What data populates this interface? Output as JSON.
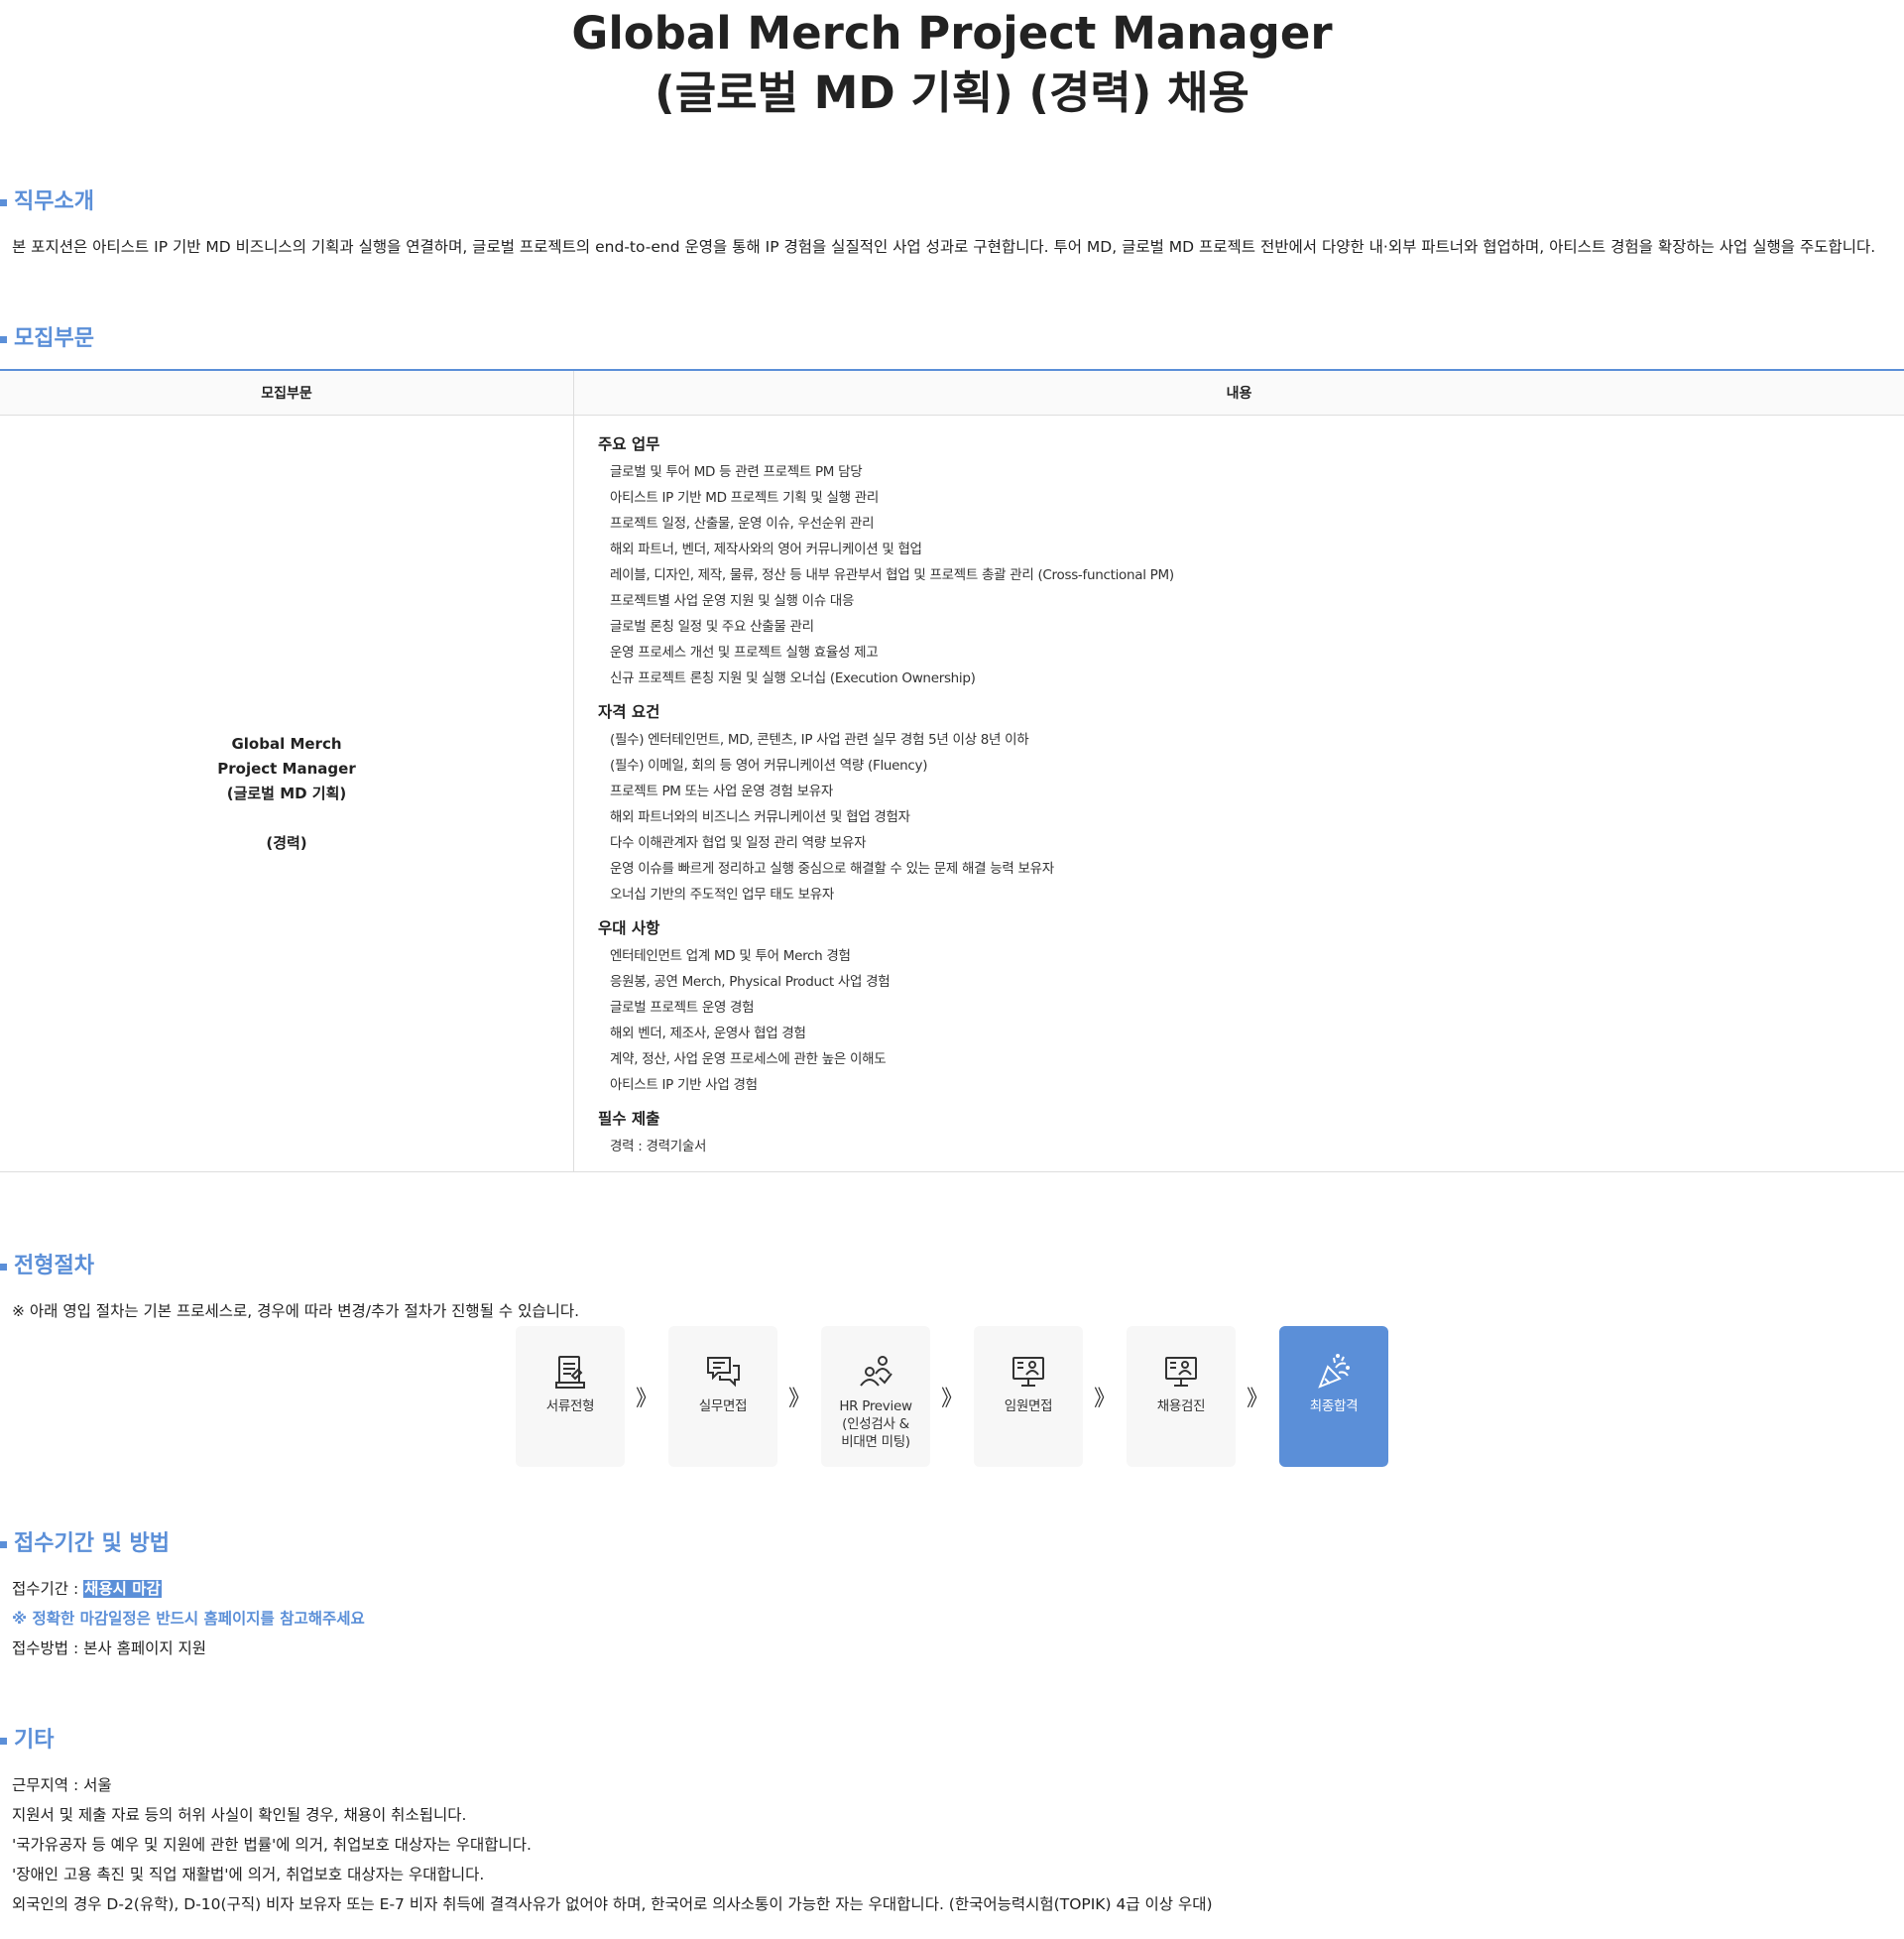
{
  "title": {
    "line1": "Global Merch Project Manager",
    "line2": "(글로벌 MD 기획) (경력) 채용"
  },
  "intro": {
    "heading": "직무소개",
    "text": "본 포지션은 아티스트 IP 기반 MD 비즈니스의 기획과 실행을 연결하며, 글로벌 프로젝트의 end-to-end 운영을 통해 IP 경험을 실질적인 사업 성과로 구현합니다. 투어 MD, 글로벌 MD 프로젝트 전반에서 다양한 내·외부 파트너와 협업하며, 아티스트 경험을 확장하는 사업 실행을 주도합니다."
  },
  "recruit": {
    "heading": "모집부문",
    "col_a_header": "모집부문",
    "col_b_header": "내용",
    "position": {
      "line1": "Global Merch",
      "line2": "Project Manager",
      "line3": "(글로벌 MD 기획)",
      "line4": "(경력)"
    },
    "groups": [
      {
        "title": "주요 업무",
        "items": [
          "글로벌 및 투어 MD 등 관련 프로젝트 PM 담당",
          "아티스트 IP 기반 MD 프로젝트 기획 및 실행 관리",
          "프로젝트 일정, 산출물, 운영 이슈, 우선순위 관리",
          "해외 파트너, 벤더, 제작사와의 영어 커뮤니케이션 및 협업",
          "레이블, 디자인, 제작, 물류, 정산 등 내부 유관부서 협업 및 프로젝트 총괄 관리 (Cross-functional PM)",
          "프로젝트별 사업 운영 지원 및 실행 이슈 대응",
          "글로벌 론칭 일정 및 주요 산출물 관리",
          "운영 프로세스 개선 및 프로젝트 실행 효율성 제고",
          "신규 프로젝트 론칭 지원 및 실행 오너십 (Execution Ownership)"
        ]
      },
      {
        "title": "자격 요건",
        "items": [
          "(필수) 엔터테인먼트, MD, 콘텐츠, IP 사업 관련 실무 경험 5년 이상 8년 이하",
          "(필수) 이메일, 회의 등 영어 커뮤니케이션 역량 (Fluency)",
          "프로젝트 PM 또는 사업 운영 경험 보유자",
          "해외 파트너와의 비즈니스 커뮤니케이션 및 협업 경험자",
          "다수 이해관계자 협업 및 일정 관리 역량 보유자",
          "운영 이슈를 빠르게 정리하고 실행 중심으로 해결할 수 있는 문제 해결 능력 보유자",
          "오너십 기반의 주도적인 업무 태도 보유자"
        ]
      },
      {
        "title": "우대 사항",
        "items": [
          "엔터테인먼트 업계 MD 및 투어 Merch 경험",
          "응원봉, 공연 Merch, Physical Product 사업 경험",
          "글로벌 프로젝트 운영 경험",
          "해외 벤더, 제조사, 운영사 협업 경험",
          "계약, 정산, 사업 운영 프로세스에 관한 높은 이해도",
          "아티스트 IP 기반 사업 경험"
        ]
      },
      {
        "title": "필수 제출",
        "items": [
          "경력 : 경력기술서"
        ]
      }
    ]
  },
  "process": {
    "heading": "전형절차",
    "note": "※ 아래 영입 절차는 기본 프로세스로, 경우에 따라 변경/추가 절차가 진행될 수 있습니다.",
    "arrow": "》",
    "steps": [
      {
        "label": "서류전형",
        "icon": "document-icon"
      },
      {
        "label": "실무면접",
        "icon": "chat-icon"
      },
      {
        "label": "HR Preview\n(인성검사 &\n비대면 미팅)",
        "icon": "people-icon"
      },
      {
        "label": "임원면접",
        "icon": "monitor-person-icon"
      },
      {
        "label": "채용검진",
        "icon": "monitor-person-icon"
      },
      {
        "label": "최종합격",
        "icon": "party-popper-icon"
      }
    ],
    "final_color": "#5b8fd8"
  },
  "apply": {
    "heading": "접수기간 및 방법",
    "period_label": "접수기간 : ",
    "period_value": "채용시 마감",
    "note": "※ 정확한 마감일정은 반드시 홈페이지를 참고해주세요",
    "method": "접수방법 : 본사 홈페이지 지원"
  },
  "etc": {
    "heading": "기타",
    "lines": [
      "근무지역 : 서울",
      "지원서 및 제출 자료 등의 허위 사실이 확인될 경우, 채용이 취소됩니다.",
      "'국가유공자 등 예우 및 지원에 관한 법률'에 의거, 취업보호 대상자는 우대합니다.",
      "'장애인 고용 촉진 및 직업 재활법'에 의거, 취업보호 대상자는 우대합니다.",
      "외국인의 경우 D-2(유학), D-10(구직) 비자 보유자 또는 E-7 비자 취득에 결격사유가 없어야 하며, 한국어로 의사소통이 가능한 자는 우대합니다. (한국어능력시험(TOPIK) 4급 이상 우대)"
    ]
  },
  "colors": {
    "accent": "#5b8fd8",
    "text": "#222222",
    "border": "#dddddd"
  }
}
